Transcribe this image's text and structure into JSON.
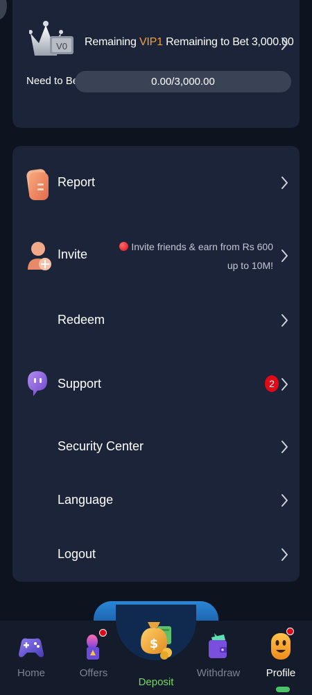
{
  "vip": {
    "badge_label": "V0",
    "remaining_prefix": "Remaining ",
    "level": "VIP1",
    "remaining_suffix": " Remaining to Bet 3,000.00",
    "need_label": "Need to Bet",
    "progress_text": "0.00/3,000.00",
    "progress_fraction": 0,
    "level_color": "#f0a23c"
  },
  "menu": {
    "items": [
      {
        "label": "Report",
        "icon": "report-icon"
      },
      {
        "label": "Invite",
        "icon": "invite-icon",
        "note": "Invite friends & earn from Rs 600 up to 10M!"
      },
      {
        "label": "Redeem"
      },
      {
        "label": "Support",
        "icon": "support-icon",
        "badge": "2"
      },
      {
        "label": "Security Center"
      },
      {
        "label": "Language"
      },
      {
        "label": "Logout"
      }
    ]
  },
  "nav": {
    "items": [
      {
        "label": "Home",
        "icon": "gamepad-icon"
      },
      {
        "label": "Offers",
        "icon": "gift-icon"
      },
      {
        "label": "Deposit",
        "icon": "money-bag-icon"
      },
      {
        "label": "Withdraw",
        "icon": "wallet-icon"
      },
      {
        "label": "Profile",
        "icon": "profile-face-icon"
      }
    ],
    "active": "Profile"
  }
}
